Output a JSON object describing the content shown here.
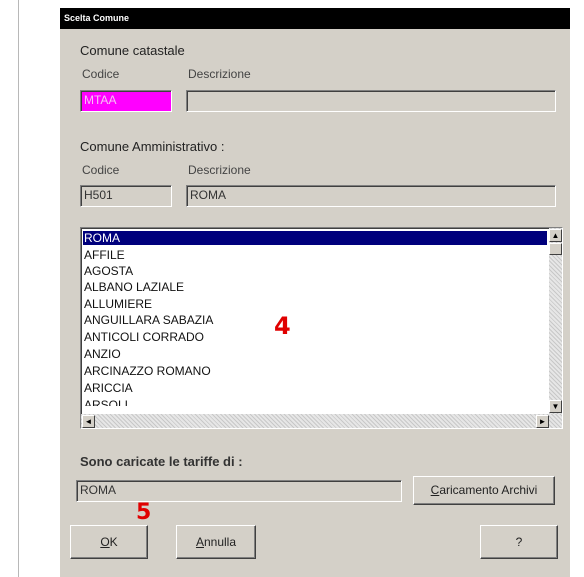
{
  "window": {
    "title": "Scelta Comune"
  },
  "catastale": {
    "heading": "Comune catastale",
    "code_label": "Codice",
    "desc_label": "Descrizione",
    "code_value": "MTAA",
    "desc_value": ""
  },
  "amministrativo": {
    "heading": "Comune Amministrativo :",
    "code_label": "Codice",
    "desc_label": "Descrizione",
    "code_value": "H501",
    "desc_value": "ROMA"
  },
  "comuni_list": {
    "items": [
      "ROMA",
      "AFFILE",
      "AGOSTA",
      "ALBANO LAZIALE",
      "ALLUMIERE",
      "ANGUILLARA SABAZIA",
      "ANTICOLI CORRADO",
      "ANZIO",
      "ARCINAZZO ROMANO",
      "ARICCIA",
      "ARSOLI"
    ],
    "selected": "ROMA"
  },
  "tariffe": {
    "heading": "Sono caricate le tariffe di :",
    "value": "ROMA"
  },
  "buttons": {
    "caricamento_prefix": "C",
    "caricamento_rest": "aricamento Archivi",
    "ok_prefix": "O",
    "ok_rest": "K",
    "annulla_prefix": "A",
    "annulla_rest": "nnulla",
    "help_label": "?"
  },
  "annotations": {
    "marker_4": "4",
    "marker_5": "5"
  },
  "colors": {
    "title_bar": "#000000",
    "selection": "#00007c",
    "code_field_highlight": "#ff00ff",
    "marker": "#e00000"
  }
}
